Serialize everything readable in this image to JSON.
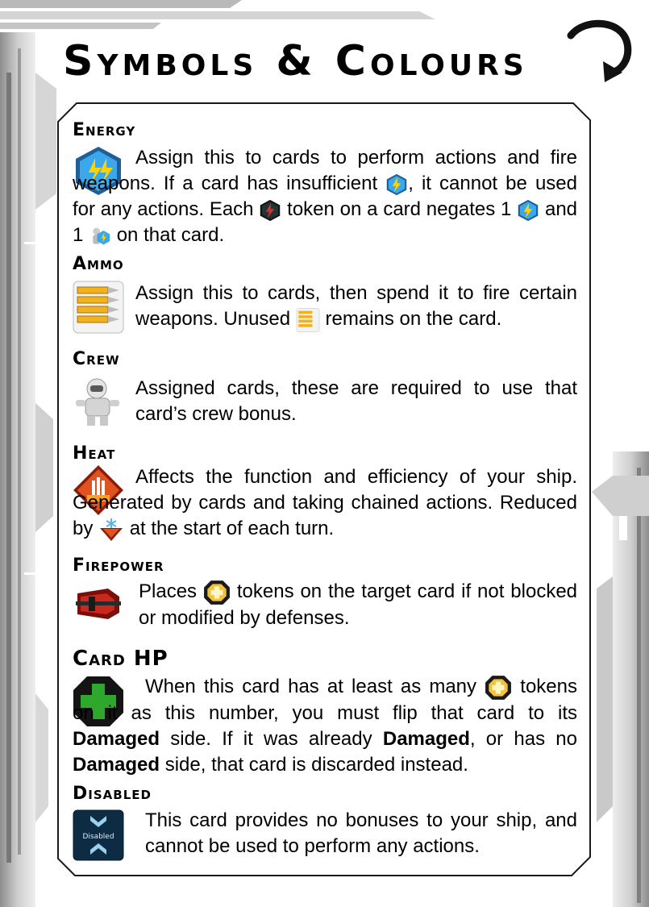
{
  "title": "Symbols & Colours",
  "sections": {
    "energy": {
      "heading": "Energy",
      "p1": "Assign this to cards to perform actions and fire weapons. If a card has insufficient",
      "p2": ", it cannot be used for any actions. Each",
      "p3": "token on a card negates 1",
      "p4": "and 1",
      "p5": "on that card."
    },
    "ammo": {
      "heading": "Ammo",
      "p1": "Assign this to cards, then spend it to fire certain weapons. Unused",
      "p2": "remains on the card."
    },
    "crew": {
      "heading": "Crew",
      "p1": "Assigned cards, these are required to use that card’s crew bonus."
    },
    "heat": {
      "heading": "Heat",
      "p1": "Affects the function and efficiency of your ship. Generated by cards and taking chained actions. Reduced by",
      "p2": "at the start of each turn."
    },
    "firepower": {
      "heading": "Firepower",
      "p1": "Places",
      "p2": "tokens on the target card if not blocked or modified by defenses."
    },
    "card_hp": {
      "heading": "Card HP",
      "p1": "When this card has at least as many",
      "p2": "tokens on it as this number, you must flip that card to its",
      "b1": "Damaged",
      "p3": "side. If it was already",
      "b2": "Damaged",
      "p4": ", or has no",
      "b3": "Damaged",
      "p5": "side, that card is discarded instead."
    },
    "disabled": {
      "heading": "Disabled",
      "icon_label": "Disabled",
      "p1": "This card provides no bonuses to your ship, and cannot be used to perform any actions."
    }
  },
  "icons": [
    "energy-hex-icon",
    "ammo-icon",
    "crew-astronaut-icon",
    "heat-icon",
    "firepower-icon",
    "card-hp-icon",
    "disabled-icon",
    "damage-token-icon",
    "cooling-icon",
    "curved-arrow-icon"
  ],
  "colors": {
    "energy": "#1e90d8",
    "ammo": "#f2b21e",
    "heat": "#d8441c",
    "hp": "#2da82d",
    "damage": "#f2b21e",
    "frame": "#1a1a1a"
  }
}
